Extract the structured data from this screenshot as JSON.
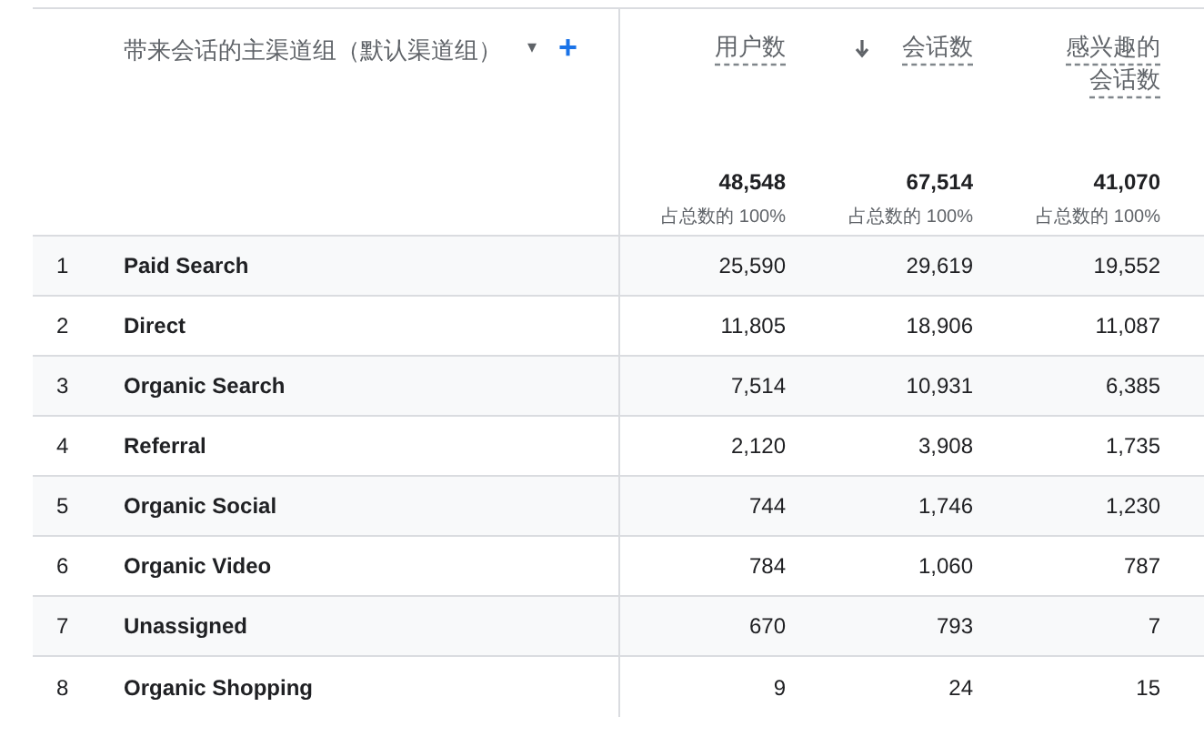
{
  "dimension_header": {
    "label": "带来会话的主渠道组（默认渠道组）",
    "dropdown": "▾",
    "add": "+"
  },
  "metrics": [
    {
      "label": "用户数",
      "sorted": false,
      "total": "48,548",
      "share": "占总数的 100%"
    },
    {
      "label": "会话数",
      "sorted": true,
      "total": "67,514",
      "share": "占总数的 100%"
    },
    {
      "label": "感兴趣的会话数",
      "sorted": false,
      "total": "41,070",
      "share": "占总数的 100%"
    }
  ],
  "rows": [
    {
      "rank": "1",
      "channel": "Paid Search",
      "values": [
        "25,590",
        "29,619",
        "19,552"
      ]
    },
    {
      "rank": "2",
      "channel": "Direct",
      "values": [
        "11,805",
        "18,906",
        "11,087"
      ]
    },
    {
      "rank": "3",
      "channel": "Organic Search",
      "values": [
        "7,514",
        "10,931",
        "6,385"
      ]
    },
    {
      "rank": "4",
      "channel": "Referral",
      "values": [
        "2,120",
        "3,908",
        "1,735"
      ]
    },
    {
      "rank": "5",
      "channel": "Organic Social",
      "values": [
        "744",
        "1,746",
        "1,230"
      ]
    },
    {
      "rank": "6",
      "channel": "Organic Video",
      "values": [
        "784",
        "1,060",
        "787"
      ]
    },
    {
      "rank": "7",
      "channel": "Unassigned",
      "values": [
        "670",
        "793",
        "7"
      ]
    },
    {
      "rank": "8",
      "channel": "Organic Shopping",
      "values": [
        "9",
        "24",
        "15"
      ]
    }
  ]
}
